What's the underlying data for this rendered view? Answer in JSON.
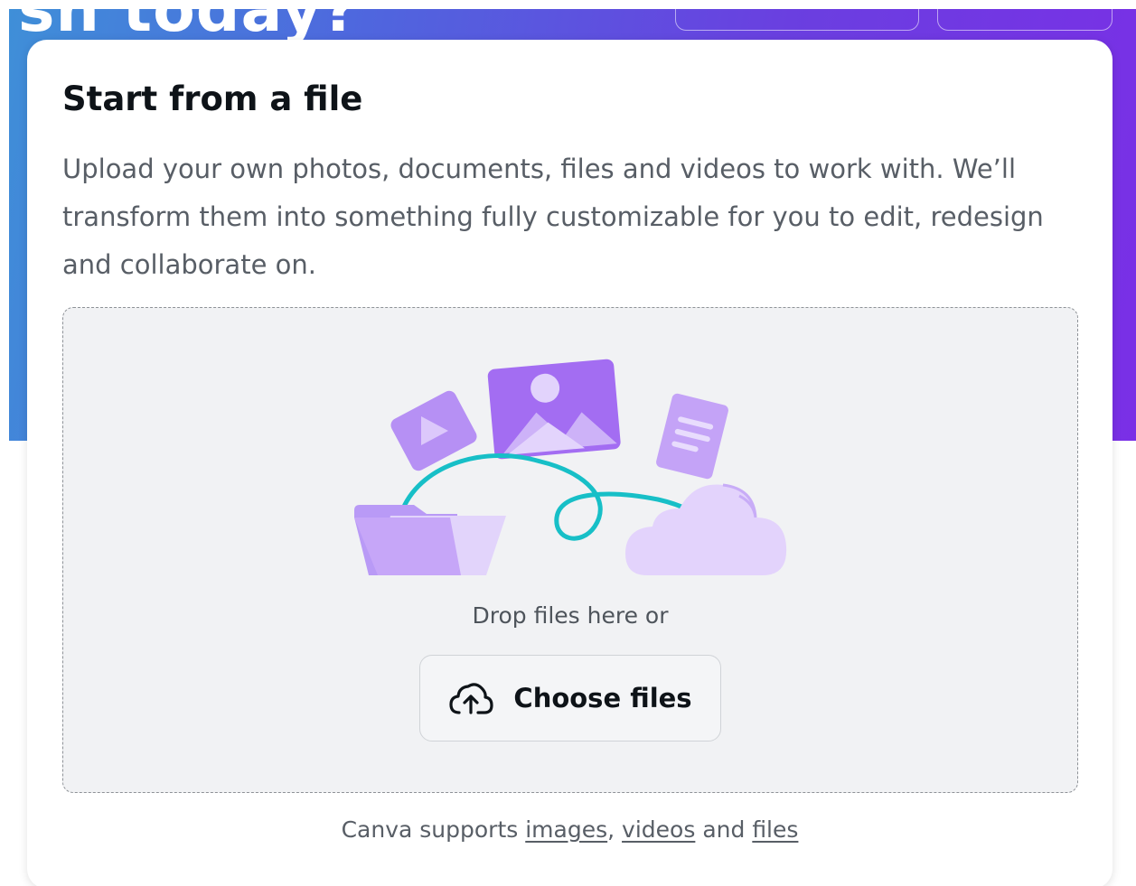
{
  "banner": {
    "heading": "sn today?"
  },
  "modal": {
    "title": "Start from a file",
    "description": "Upload your own photos, documents, files and videos to work with. We’ll transform them into something fully customizable for you to edit, redesign and collaborate on.",
    "dropzone": {
      "prompt": "Drop files here or",
      "choose_label": "Choose files",
      "choose_icon": "cloud-upload-icon"
    },
    "footer": {
      "prefix": "Canva supports",
      "link_images": "images",
      "sep_comma": ",",
      "link_videos": "videos",
      "sep_and": "and",
      "link_files": "files"
    }
  },
  "colors": {
    "accent_purple": "#a970f0",
    "accent_teal": "#14c0c8",
    "banner_gradient_start": "#3f8fd8",
    "banner_gradient_end": "#7a2fe6"
  }
}
